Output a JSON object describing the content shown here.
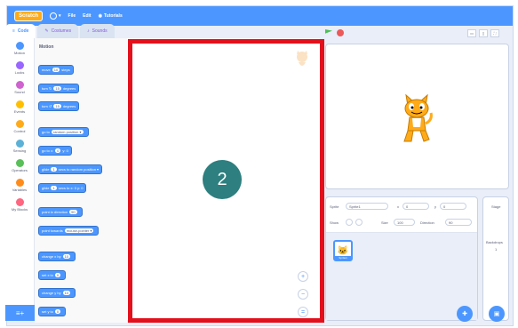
{
  "menubar": {
    "logo": "Scratch",
    "file": "File",
    "edit": "Edit",
    "tutorials": "Tutorials"
  },
  "tabs": [
    {
      "label": "Code",
      "icon": "code-icon"
    },
    {
      "label": "Costumes",
      "icon": "brush-icon"
    },
    {
      "label": "Sounds",
      "icon": "speaker-icon"
    }
  ],
  "categories": [
    {
      "label": "Motion",
      "color": "#4c97ff"
    },
    {
      "label": "Looks",
      "color": "#9966ff"
    },
    {
      "label": "Sound",
      "color": "#cf63cf"
    },
    {
      "label": "Events",
      "color": "#ffbf00"
    },
    {
      "label": "Control",
      "color": "#ffab19"
    },
    {
      "label": "Sensing",
      "color": "#5cb1d6"
    },
    {
      "label": "Operators",
      "color": "#59c059"
    },
    {
      "label": "Variables",
      "color": "#ff8c1a"
    },
    {
      "label": "My Blocks",
      "color": "#ff6680"
    }
  ],
  "palette": {
    "title": "Motion",
    "blocks": [
      {
        "text": "move",
        "value": "10",
        "suffix": "steps"
      },
      {
        "text": "turn ↻",
        "value": "15",
        "suffix": "degrees"
      },
      {
        "text": "turn ↺",
        "value": "15",
        "suffix": "degrees"
      },
      {
        "text": "go to",
        "value": "random position ▾",
        "suffix": ""
      },
      {
        "text": "go to x:",
        "value": "0",
        "suffix": "y: 0"
      },
      {
        "text": "glide",
        "value": "1",
        "suffix": "secs to random position ▾"
      },
      {
        "text": "glide",
        "value": "1",
        "suffix": "secs to x: 0 y: 0"
      },
      {
        "text": "point in direction",
        "value": "90",
        "suffix": ""
      },
      {
        "text": "point towards",
        "value": "mouse-pointer ▾",
        "suffix": ""
      },
      {
        "text": "change x by",
        "value": "10",
        "suffix": ""
      },
      {
        "text": "set x to",
        "value": "0",
        "suffix": ""
      },
      {
        "text": "change y by",
        "value": "10",
        "suffix": ""
      },
      {
        "text": "set y to",
        "value": "0",
        "suffix": ""
      }
    ]
  },
  "step_badge": "2",
  "sprite_info": {
    "sprite_label": "Sprite",
    "sprite_name": "Sprite1",
    "x_label": "x",
    "x_value": "0",
    "y_label": "y",
    "y_value": "0",
    "show_label": "Show",
    "size_label": "Size",
    "size_value": "100",
    "direction_label": "Direction",
    "direction_value": "90"
  },
  "sprites": [
    {
      "name": "Sprite1"
    }
  ],
  "stage_pane": {
    "title": "Stage",
    "backdrops_label": "Backdrops",
    "backdrops_count": "1"
  },
  "colors": {
    "accent": "#4c97ff",
    "highlight": "#e3101c",
    "badge": "#2e7f7f"
  }
}
